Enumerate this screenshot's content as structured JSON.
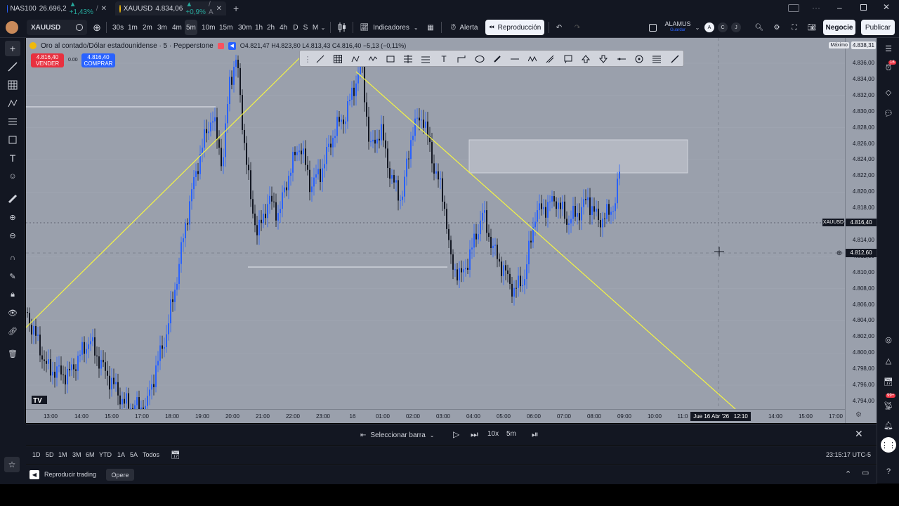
{
  "browser_tabs": [
    {
      "symbol": "NAS100",
      "price": "26.696,2",
      "change": "▲ +1,43%",
      "suffix": "/"
    },
    {
      "symbol": "XAUUSD",
      "price": "4.834,06",
      "change": "▲ +0,9%",
      "suffix": "/ A"
    }
  ],
  "toolbar": {
    "symbol": "XAUUSD",
    "intervals": [
      "30s",
      "1m",
      "2m",
      "3m",
      "4m",
      "5m",
      "10m",
      "15m",
      "30m",
      "1h",
      "2h",
      "4h",
      "D",
      "S",
      "M"
    ],
    "active_interval": "5m",
    "indicators_label": "Indicadores",
    "alert_label": "Alerta",
    "replay_label": "Reproducción",
    "layout_name": "ALAMUS",
    "layout_sub": "Guardar",
    "trade_label": "Negocie",
    "publish_label": "Publicar",
    "circle_letters": [
      "A",
      "C",
      "J"
    ]
  },
  "legend": {
    "title": "Oro al contado/Dólar estadounidense · 5 · Pepperstone",
    "ohlc": "O4.821,47  H4.823,80  L4.813,43  C4.816,40  −5,13 (−0,11%)",
    "sell_price": "4.816,40",
    "sell_label": "VENDER",
    "spread": "0.00",
    "buy_price": "4.816,40",
    "buy_label": "COMPRAR"
  },
  "price_axis": {
    "max_label": "Máximo",
    "max_value": "4.838,31",
    "ticks": [
      "4.836,00",
      "4.834,00",
      "4.832,00",
      "4.830,00",
      "4.828,00",
      "4.826,00",
      "4.824,00",
      "4.822,00",
      "4.820,00",
      "4.818,00",
      "4.816,00",
      "4.814,00",
      "4.812,00",
      "4.810,00",
      "4.808,00",
      "4.806,00",
      "4.804,00",
      "4.802,00",
      "4.800,00",
      "4.798,00",
      "4.796,00",
      "4.794,00"
    ],
    "symbol_tag": "XAUUSD",
    "current_price": "4.816,40",
    "cursor_price": "4.812,60"
  },
  "time_axis": {
    "ticks": [
      "13:00",
      "14:00",
      "15:00",
      "17:00",
      "18:00",
      "19:00",
      "20:00",
      "21:00",
      "22:00",
      "23:00",
      "16",
      "01:00",
      "02:00",
      "03:00",
      "04:00",
      "05:00",
      "06:00",
      "07:00",
      "08:00",
      "09:00",
      "10:00",
      "11:0",
      "14:00",
      "15:00",
      "17:00"
    ],
    "cursor_label": "Jue 16 Abr '26   12:10"
  },
  "replay_bar": {
    "select_label": "Seleccionar barra",
    "speed": "10x",
    "interval": "5m"
  },
  "range_bar": {
    "ranges": [
      "1D",
      "5D",
      "1M",
      "3M",
      "6M",
      "YTD",
      "1A",
      "5A",
      "Todos"
    ],
    "clock": "23:15:17 UTC-5"
  },
  "bottom_bar": {
    "replay_trading_label": "Reproducir trading",
    "trade_label": "Opere"
  },
  "notifications": {
    "badge1": "16",
    "badge2": "99+"
  },
  "colors": {
    "bull": "#2962ff",
    "bear": "#131722",
    "trendline": "#f5f542",
    "chart_bg": "#9aa0ac"
  }
}
